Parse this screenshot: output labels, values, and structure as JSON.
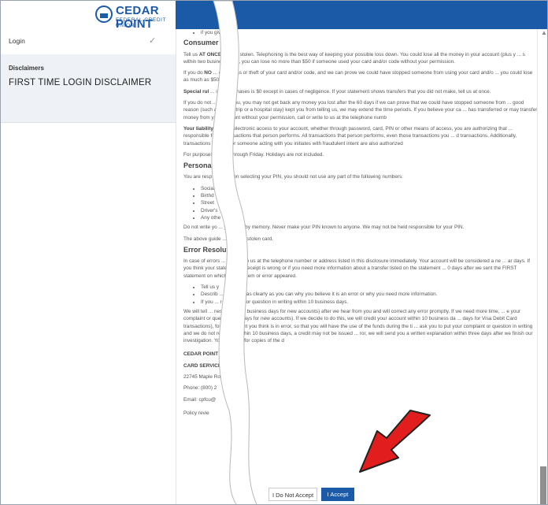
{
  "logo": {
    "name": "CEDAR POINT",
    "sub": "FEDERAL CREDIT UNION"
  },
  "sidebar": {
    "login_label": "Login",
    "login_check": "✓",
    "disclaimers_header": "Disclaimers",
    "active_item": "FIRST TIME LOGIN DISCLAIMER"
  },
  "doc": {
    "top_fragment": "if you give u",
    "consumer_heading": "Consumer Lia",
    "c1_a": "Tell us ",
    "c1_b": "AT ONCE",
    "c1_c": " ... et or stolen. Telephoning is the best way of keeping your possible loss down. You could lose all the money in your account (plus y ... s within two business days, you can lose no more than $50 if someone used your card and/or code without your permission.",
    "c2_a": "If you do ",
    "c2_b": "NO",
    "c2_c": " ... of the loss or theft of your card and/or code, and we can prove we could have stopped someone from using your card and/o ... you could lose as much as $500.",
    "c3_a": "Special rul",
    "c3_c": " ... ized purchases is $0 except in cases of negligence. If your statement shows transfers that you did not make, tell us at once.",
    "c4": "If you do not ... led to you, you may not get back any money you lost after the 60 days if we can prove that we could have stopped someone from ... good reason (such as a long trip or a hospital stay) kept you from telling us, we may extend the time periods. If you believe your ca ... has transferred or may transfer money from your account without your permission, call or write to us at the telephone numb",
    "c5_a": "Your liability fo",
    "c5_c": " ... he electronic access to your account, whether through password, card, PIN or other means of access, you are authorizing that ... responsible for all transactions that person performs. All transactions that person performs, even those transactions you ... d transactions. Additionally, transactions that you or someone acting with you initiates with fraudulent intent are also authorized",
    "c6": "For purposes o ... ay through Friday. Holidays are not included.",
    "personal_heading": "Personal I",
    "p1": "You are resp ... nt. When selecting your PIN, you should not use any part of the following numbers:",
    "pin_list": [
      "Social",
      "Birthd",
      "Street",
      "Driver's",
      "Any othe"
    ],
    "p2": "Do not write yo ... your PIN by memory. Never make your PIN known to anyone. We may not be held responsible for your PIN.",
    "p3": "The above guide ... a lost or stolen card.",
    "error_heading": "Error Resolut",
    "e1": "In case of errors ... or write to us at the telephone number or address listed in this disclosure immediately. Your account will be considered a ne ... ar days. If you think your statement or receipt is wrong or if you need more information about a transfer listed on the statement ... 0 days after we sent the FIRST statement on which the problem or error appeared.",
    "error_list": [
      "Tell us y",
      "Describ ... 0 explain as clearly as you can why you believe it is an error or why you need more information.",
      "If you ... r complaint or question in writing within 10 business days."
    ],
    "e2": "We will tell ... ness days (20 business days for new accounts) after we hear from you and will correct any error promptly. If we need more time, ... e your complaint or question (90 days for new accounts). If we decide to do this, we will credit your account within 10 business da ... days for Visa Debit Card transactions), for the amount you think is in error, so that you will have the use of the funds during the ti ... ask you to put your complaint or question in writing and we do not receive it within 10 business days, a credit may not be issued ... ror, we will send you a written explanation within three days after we finish our investigation. You may ask for copies of the d",
    "contact_name": "CEDAR POINT F",
    "contact_services": "CARD SERVICES",
    "contact_address": "22745 Maple Ro",
    "contact_phone": "Phone: (800) 2",
    "contact_email": "Email: cpfcu@",
    "policy": "Policy revie"
  },
  "buttons": {
    "decline": "I Do Not Accept",
    "accept": "I Accept"
  },
  "colors": {
    "brand": "#1a5aa6",
    "arrow": "#e21d1d"
  }
}
